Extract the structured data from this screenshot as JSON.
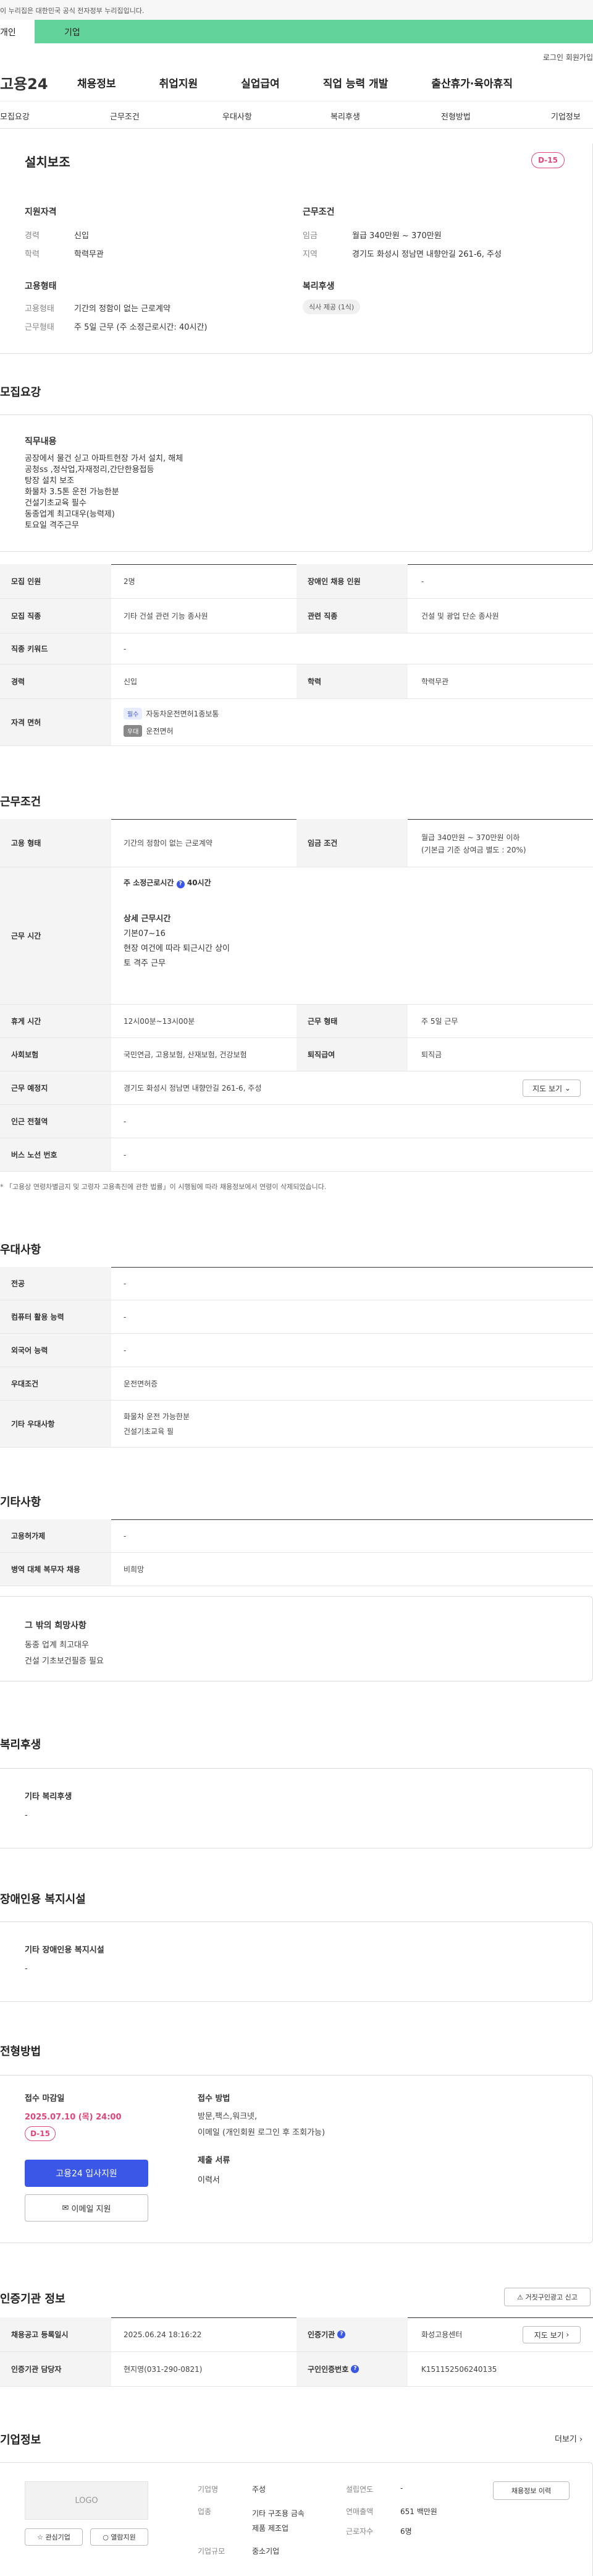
{
  "gov_banner": "이 누리집은 대한민국 공식 전자정부 누리집입니다.",
  "top_tabs": {
    "individual": "개인",
    "company": "기업"
  },
  "util": {
    "login": "로그인",
    "join": "회원가입"
  },
  "logo": "고용24",
  "gnb": [
    "채용정보",
    "취업지원",
    "실업급여",
    "직업 능력 개발",
    "출산휴가·육아휴직"
  ],
  "subnav": [
    "모집요강",
    "근무조건",
    "우대사항",
    "복리후생",
    "전형방법",
    "기업정보"
  ],
  "summary": {
    "title": "설치보조",
    "dday": "D-15",
    "qual_title": "지원자격",
    "career_label": "경력",
    "career": "신입",
    "edu_label": "학력",
    "edu": "학력무관",
    "emp_title": "고용형태",
    "emp_type_label": "고용형태",
    "emp_type": "기간의 정함이 없는 근로계약",
    "work_form_label": "근무형태",
    "work_form": "주 5일 근무 (주 소정근로시간: 40시간)",
    "cond_title": "근무조건",
    "wage_label": "임금",
    "wage": "월급 340만원 ~ 370만원",
    "loc_label": "지역",
    "loc": "경기도 화성시 정남면 내향안길 261-6, 주성",
    "welfare_title": "복리후생",
    "welfare_chip": "식사 제공 (1식)"
  },
  "recruit": {
    "title": "모집요강",
    "duty_title": "직무내용",
    "duty_lines": [
      "공장에서 물건 싣고 아파트현장 가서 설치, 해체",
      "공청ss ,정삭업,자재정리,간단한용접등",
      "탕장 설치 보조",
      "화물차 3.5톤 운전 가능한분",
      "건설기초교육 필수",
      "동종업계 최고대우(능력제)",
      "토요일 격주근무"
    ],
    "rows": [
      {
        "k1": "모집 인원",
        "v1": "2명",
        "k2": "장애인 채용 인원",
        "v2": "-"
      },
      {
        "k1": "모집 직종",
        "v1": "기타 건설 관련 기능 종사원",
        "k2": "관련 직종",
        "v2": "건설 및 광업 단순 종사원"
      },
      {
        "k1": "직종 키워드",
        "v1": "-"
      },
      {
        "k1": "경력",
        "v1": "신입",
        "k2": "학력",
        "v2": "학력무관"
      }
    ],
    "license_label": "자격 면허",
    "license_items": [
      {
        "tag": "필수",
        "name": "자동차운전면허1종보통"
      },
      {
        "tag": "우대",
        "name": "운전면허"
      }
    ]
  },
  "work": {
    "title": "근무조건",
    "emp_label": "고용 형태",
    "emp": "기간의 정함이 없는 근로계약",
    "wage_label": "임금 조건",
    "wage1": "월급 340만원 ~ 370만원 이하",
    "wage2": "(기본급 기준 상여금 별도 : 20%)",
    "hours_label": "근무 시간",
    "hours_head": "주 소정근로시간",
    "hours_q": "?",
    "hours_val": "40시간",
    "detail_title": "상세 근무시간",
    "detail_lines": [
      "기본07~16",
      "현장 여건에 따라 퇴근시간 상이",
      "토 격주 근무"
    ],
    "rest_label": "휴게 시간",
    "rest": "12시00분~13시00분",
    "form_label": "근무 형태",
    "form": "주 5일 근무",
    "ins_label": "사회보험",
    "ins": "국민연금, 고용보험, 산재보험, 건강보험",
    "sev_label": "퇴직급여",
    "sev": "퇴직금",
    "place_label": "근무 예정지",
    "place": "경기도 화성시 정남면 내향안길 261-6, 주성",
    "map_btn": "지도 보기",
    "subway_label": "인근 전철역",
    "subway": "-",
    "bus_label": "버스 노선 번호",
    "bus": "-",
    "note": "* 「고용상 연령차별금지 및 고령자 고용촉진에 관한 법률」이 시행됨에 따라 채용정보에서 연령이 삭제되었습니다."
  },
  "pref": {
    "title": "우대사항",
    "rows": [
      {
        "k": "전공",
        "v": "-"
      },
      {
        "k": "컴퓨터 활용 능력",
        "v": "-"
      },
      {
        "k": "외국어 능력",
        "v": "-"
      },
      {
        "k": "우대조건",
        "v": "운전면허증"
      }
    ],
    "etc_label": "기타 우대사항",
    "etc_lines": [
      "화물차 운전 가능한분",
      "건설기초교육 필"
    ]
  },
  "other": {
    "title": "기타사항",
    "rows": [
      {
        "k": "고용허가제",
        "v": "-"
      },
      {
        "k": "병역 대체 복무자 채용",
        "v": "비희망"
      }
    ],
    "hope_title": "그 밖의 희망사항",
    "hope_lines": [
      "동종 업계 최고대우",
      "건설 기초보건필증 필요"
    ]
  },
  "welfare": {
    "title": "복리후생",
    "box_title": "기타 복리후생",
    "box_val": "-"
  },
  "disabled": {
    "title": "장애인용 복지시설",
    "box_title": "기타 장애인용 복지시설",
    "box_val": "-"
  },
  "screening": {
    "title": "전형방법",
    "deadline_title": "접수 마감일",
    "deadline": "2025.07.10 (목) 24:00",
    "dday": "D-15",
    "apply_btn": "고용24 입사지원",
    "email_btn": "이메일 지원",
    "method_title": "접수 방법",
    "method_lines": [
      "방문,팩스,워크넷,",
      "이메일 (개인회원 로그인 후 조회가능)"
    ],
    "docs_title": "제출 서류",
    "docs": "이력서"
  },
  "cert": {
    "title": "인증기관 정보",
    "report_btn": "거짓구인광고 신고",
    "reg_label": "채용공고 등록일시",
    "reg": "2025.06.24 18:16:22",
    "org_label": "인증기관",
    "org": "화성고용센터",
    "map_btn": "지도 보기",
    "mgr_label": "인증기관 담당자",
    "mgr": "현지영(031-290-0821)",
    "no_label": "구인인증번호",
    "no": "K151152506240135"
  },
  "company": {
    "title": "기업정보",
    "more": "더보기",
    "logo_text": "LOGO",
    "fav_btn": "관심기업",
    "visit_btn": "열람지원",
    "name_label": "기업명",
    "name": "주성",
    "industry_label": "업종",
    "industry1": "기타 구조용 금속",
    "industry2": "제품 제조업",
    "size_label": "기업규모",
    "size": "중소기업",
    "year_label": "설립연도",
    "year": "-",
    "sales_label": "연매출액",
    "sales": "651 백만원",
    "emp_label": "근로자수",
    "emp": "6명",
    "jobs_btn": "채용정보 이력"
  }
}
